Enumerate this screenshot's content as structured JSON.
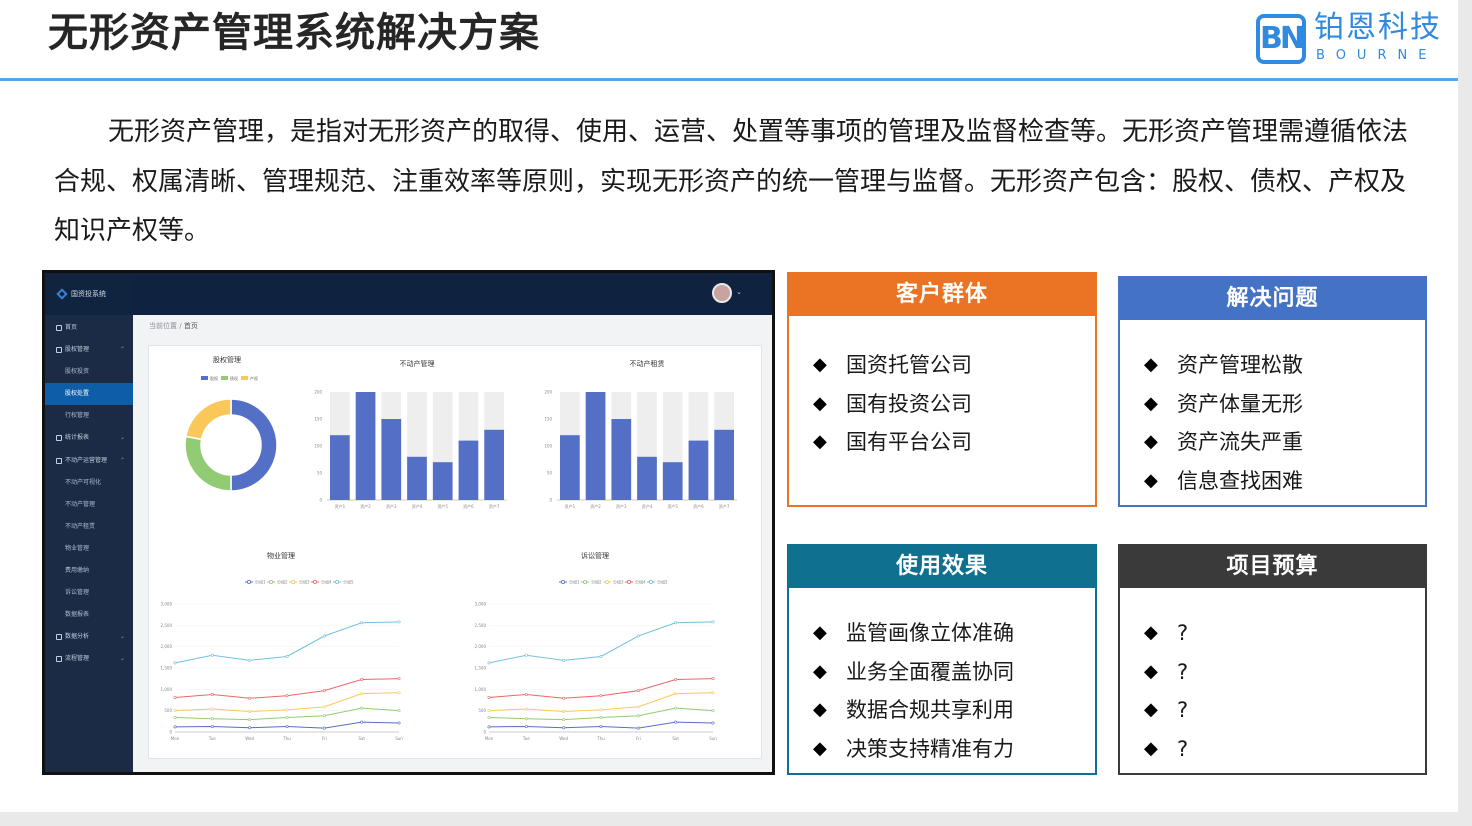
{
  "header": {
    "title": "无形资产管理系统解决方案",
    "logo_cn": "铂恩科技",
    "logo_en": "BOURNE",
    "logo_mark": "BN"
  },
  "intro": "无形资产管理，是指对无形资产的取得、使用、运营、处置等事项的管理及监督检查等。无形资产管理需遵循依法合规、权属清晰、管理规范、注重效率等原则，实现无形资产的统一管理与监督。无形资产包含：股权、债权、产权及知识产权等。",
  "dashboard": {
    "app_name": "国资投系统",
    "breadcrumb_prefix": "当前位置",
    "breadcrumb_sep": "/",
    "breadcrumb_current": "首页",
    "nav": [
      {
        "label": "首页",
        "level": "top"
      },
      {
        "label": "股权管理",
        "level": "top",
        "caret": "⌃"
      },
      {
        "label": "股权投资",
        "level": "sub"
      },
      {
        "label": "股权处置",
        "level": "sub",
        "active": true
      },
      {
        "label": "行权管理",
        "level": "sub"
      },
      {
        "label": "统计报表",
        "level": "top",
        "caret": "⌄"
      },
      {
        "label": "不动产运营管理",
        "level": "top",
        "caret": "⌃"
      },
      {
        "label": "不动产可视化",
        "level": "sub"
      },
      {
        "label": "不动产管理",
        "level": "sub"
      },
      {
        "label": "不动产租赁",
        "level": "sub"
      },
      {
        "label": "物业管理",
        "level": "sub"
      },
      {
        "label": "费用缴纳",
        "level": "sub"
      },
      {
        "label": "诉讼管理",
        "level": "sub"
      },
      {
        "label": "数据报表",
        "level": "sub"
      },
      {
        "label": "数据分析",
        "level": "top",
        "caret": "⌄"
      },
      {
        "label": "流程管理",
        "level": "top",
        "caret": "⌄"
      }
    ]
  },
  "colors": {
    "orange": "#ea7424",
    "blue": "#4472c4",
    "teal": "#10708f",
    "dark": "#3a3a3a",
    "bar": "#5470c6",
    "rule": "#5aa5e6"
  },
  "chart_data": [
    {
      "type": "pie",
      "title": "股权管理",
      "legend": [
        "股权",
        "债权",
        "产权"
      ],
      "values": [
        50,
        28,
        22
      ],
      "colors": [
        "#5470c6",
        "#91cc75",
        "#fac858"
      ]
    },
    {
      "type": "bar",
      "title": "不动产管理",
      "categories": [
        "资产1",
        "资产2",
        "资产3",
        "资产4",
        "资产5",
        "资产6",
        "资产7"
      ],
      "values": [
        120,
        200,
        150,
        80,
        70,
        110,
        130
      ],
      "ylim": [
        0,
        200
      ],
      "yticks": [
        "0",
        "50",
        "100",
        "150",
        "200"
      ]
    },
    {
      "type": "bar",
      "title": "不动产租赁",
      "categories": [
        "资产1",
        "资产2",
        "资产3",
        "资产4",
        "资产5",
        "资产6",
        "资产7"
      ],
      "values": [
        120,
        200,
        150,
        80,
        70,
        110,
        130
      ],
      "ylim": [
        0,
        200
      ],
      "yticks": [
        "0",
        "50",
        "100",
        "150",
        "200"
      ]
    },
    {
      "type": "line",
      "title": "物业管理",
      "categories": [
        "Mon",
        "Tue",
        "Wed",
        "Thu",
        "Fri",
        "Sat",
        "Sun"
      ],
      "ylim": [
        0,
        3000
      ],
      "yticks": [
        "0",
        "500",
        "1,000",
        "1,500",
        "2,000",
        "2,500",
        "3,000"
      ],
      "series": [
        {
          "name": "分组1",
          "color": "#5470c6",
          "values": [
            120,
            130,
            100,
            130,
            90,
            230,
            210
          ]
        },
        {
          "name": "分组2",
          "color": "#91cc75",
          "values": [
            340,
            310,
            290,
            340,
            380,
            560,
            500
          ]
        },
        {
          "name": "分组3",
          "color": "#fac858",
          "values": [
            500,
            540,
            480,
            520,
            590,
            900,
            920
          ]
        },
        {
          "name": "分组4",
          "color": "#ee6666",
          "values": [
            810,
            880,
            790,
            850,
            970,
            1230,
            1250
          ]
        },
        {
          "name": "分组5",
          "color": "#73c0de",
          "values": [
            1620,
            1800,
            1680,
            1770,
            2250,
            2560,
            2580
          ]
        }
      ]
    },
    {
      "type": "line",
      "title": "诉讼管理",
      "categories": [
        "Mon",
        "Tue",
        "Wed",
        "Thu",
        "Fri",
        "Sat",
        "Sun"
      ],
      "ylim": [
        0,
        3000
      ],
      "yticks": [
        "0",
        "500",
        "1,000",
        "1,500",
        "2,000",
        "2,500",
        "3,000"
      ],
      "series": [
        {
          "name": "分组1",
          "color": "#5470c6",
          "values": [
            120,
            130,
            100,
            130,
            90,
            230,
            210
          ]
        },
        {
          "name": "分组2",
          "color": "#91cc75",
          "values": [
            340,
            310,
            290,
            340,
            380,
            560,
            500
          ]
        },
        {
          "name": "分组3",
          "color": "#fac858",
          "values": [
            500,
            540,
            480,
            520,
            590,
            900,
            920
          ]
        },
        {
          "name": "分组4",
          "color": "#ee6666",
          "values": [
            810,
            880,
            790,
            850,
            970,
            1230,
            1250
          ]
        },
        {
          "name": "分组5",
          "color": "#73c0de",
          "values": [
            1620,
            1800,
            1680,
            1770,
            2250,
            2560,
            2580
          ]
        }
      ]
    }
  ],
  "boxes": {
    "customers": {
      "title": "客户群体",
      "items": [
        "国资托管公司",
        "国有投资公司",
        "国有平台公司"
      ]
    },
    "problems": {
      "title": "解决问题",
      "items": [
        "资产管理松散",
        "资产体量无形",
        "资产流失严重",
        "信息查找困难"
      ]
    },
    "effects": {
      "title": "使用效果",
      "items": [
        "监管画像立体准确",
        "业务全面覆盖协同",
        "数据合规共享利用",
        "决策支持精准有力"
      ]
    },
    "budget": {
      "title": "项目预算",
      "items": [
        "?",
        "?",
        "?",
        "?"
      ]
    },
    "bullet": "◆"
  }
}
